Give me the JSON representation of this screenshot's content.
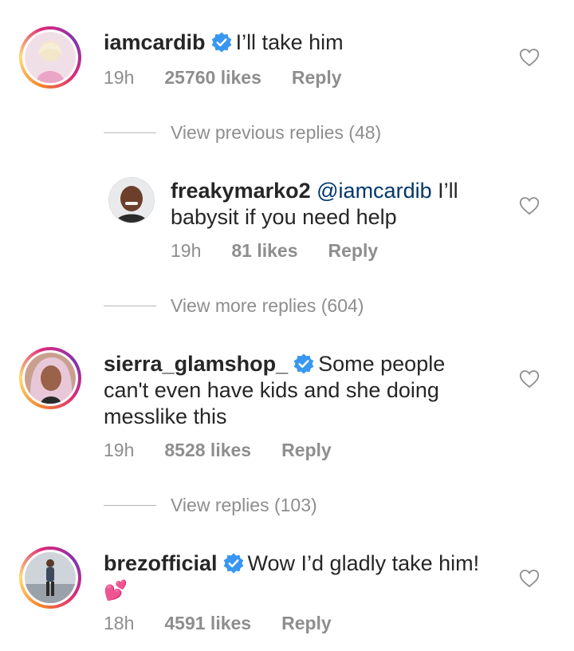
{
  "comments": [
    {
      "username": "iamcardib",
      "verified": true,
      "text": "I’ll take him",
      "time": "19h",
      "likes": "25760 likes",
      "reply": "Reply"
    },
    {
      "username": "freakymarko2",
      "verified": false,
      "mention": "@iamcardib",
      "text": "I’ll babysit if you need help",
      "time": "19h",
      "likes": "81 likes",
      "reply": "Reply"
    },
    {
      "username": "sierra_glamshop_",
      "verified": true,
      "text": "Some people can't even have kids and she doing messlike this",
      "time": "19h",
      "likes": "8528 likes",
      "reply": "Reply"
    },
    {
      "username": "brezofficial",
      "verified": true,
      "text": "Wow I’d gladly take him!",
      "emoji": "💕",
      "time": "18h",
      "likes": "4591 likes",
      "reply": "Reply"
    }
  ],
  "reply_toggles": [
    "View previous replies (48)",
    "View more replies (604)",
    "View replies (103)"
  ],
  "colors": {
    "text": "#262626",
    "meta": "#8e8e8e",
    "verified": "#3897f0",
    "mention": "#00376b",
    "emoji": "#e0457b"
  }
}
